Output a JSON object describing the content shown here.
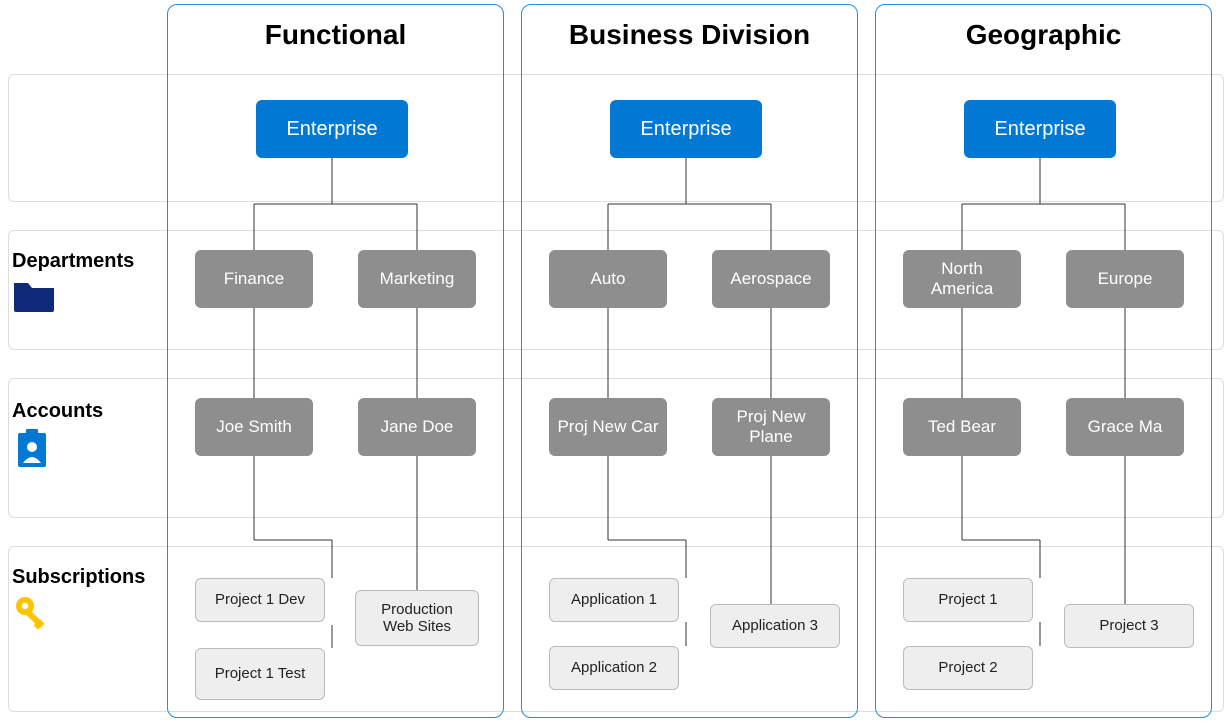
{
  "rows": {
    "departments": "Departments",
    "accounts": "Accounts",
    "subscriptions": "Subscriptions"
  },
  "columns": [
    {
      "title": "Functional",
      "root": "Enterprise",
      "departments": [
        "Finance",
        "Marketing"
      ],
      "accounts": [
        "Joe Smith",
        "Jane Doe"
      ],
      "subscriptions": [
        [
          "Project 1 Dev",
          "Project 1 Test"
        ],
        [
          "Production Web Sites"
        ]
      ]
    },
    {
      "title": "Business Division",
      "root": "Enterprise",
      "departments": [
        "Auto",
        "Aerospace"
      ],
      "accounts": [
        "Proj New Car",
        "Proj New Plane"
      ],
      "subscriptions": [
        [
          "Application 1",
          "Application 2"
        ],
        [
          "Application 3"
        ]
      ]
    },
    {
      "title": "Geographic",
      "root": "Enterprise",
      "departments": [
        "North America",
        "Europe"
      ],
      "accounts": [
        "Ted Bear",
        "Grace Ma"
      ],
      "subscriptions": [
        [
          "Project 1",
          "Project 2"
        ],
        [
          "Project 3"
        ]
      ]
    }
  ],
  "colors": {
    "blue": "#0078d4",
    "gray": "#8e8e8e",
    "leafBg": "#eeeeee",
    "borderBlue": "#1f8ded",
    "darkBlue": "#0f2a7a",
    "yellow": "#ffc400"
  }
}
